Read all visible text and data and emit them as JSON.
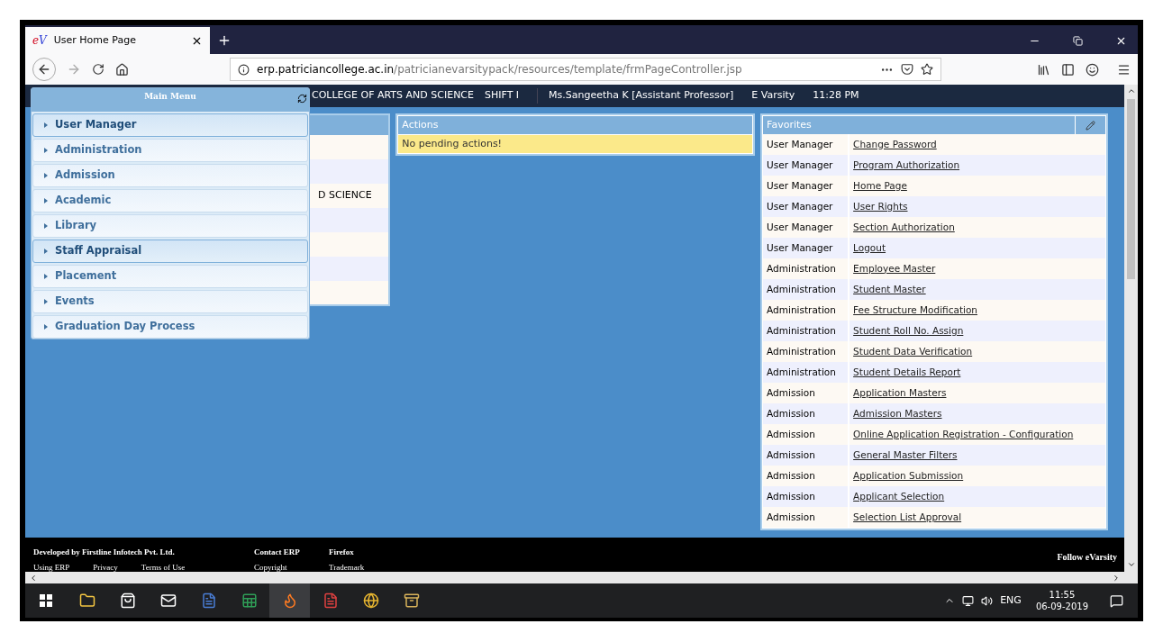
{
  "browser": {
    "logo": [
      "e",
      "V"
    ],
    "tab_title": "User Home Page",
    "url_host": "erp.patriciancollege.ac.in",
    "url_path": "/patricianevarsitypack/resources/template/frmPageController.jsp"
  },
  "header": {
    "college": "COLLEGE OF ARTS AND SCIENCE",
    "shift": "SHIFT I",
    "user": "Ms.Sangeetha K [Assistant Professor]",
    "app": "E Varsity",
    "time": "11:28 PM"
  },
  "main_menu": {
    "title": "Main Menu",
    "items": [
      {
        "label": "User Manager",
        "selected": true
      },
      {
        "label": "Administration",
        "selected": false
      },
      {
        "label": "Admission",
        "selected": false
      },
      {
        "label": "Academic",
        "selected": false
      },
      {
        "label": "Library",
        "selected": false
      },
      {
        "label": "Staff Appraisal",
        "selected": true
      },
      {
        "label": "Placement",
        "selected": false
      },
      {
        "label": "Events",
        "selected": false
      },
      {
        "label": "Graduation Day Process",
        "selected": false
      }
    ]
  },
  "info_panel": {
    "rows": [
      "",
      "",
      "D SCIENCE",
      "",
      "",
      "",
      ""
    ]
  },
  "actions": {
    "title": "Actions",
    "message": "No pending actions!"
  },
  "favorites": {
    "title": "Favorites",
    "rows": [
      {
        "module": "User Manager",
        "link": "Change Password"
      },
      {
        "module": "User Manager",
        "link": "Program Authorization"
      },
      {
        "module": "User Manager",
        "link": "Home Page"
      },
      {
        "module": "User Manager",
        "link": "User Rights"
      },
      {
        "module": "User Manager",
        "link": "Section Authorization"
      },
      {
        "module": "User Manager",
        "link": "Logout"
      },
      {
        "module": "Administration",
        "link": "Employee Master"
      },
      {
        "module": "Administration",
        "link": "Student Master"
      },
      {
        "module": "Administration",
        "link": "Fee Structure Modification"
      },
      {
        "module": "Administration",
        "link": "Student Roll No. Assign"
      },
      {
        "module": "Administration",
        "link": "Student Data Verification"
      },
      {
        "module": "Administration",
        "link": "Student Details Report"
      },
      {
        "module": "Admission",
        "link": "Application Masters"
      },
      {
        "module": "Admission",
        "link": "Admission Masters"
      },
      {
        "module": "Admission",
        "link": "Online Application Registration - Configuration"
      },
      {
        "module": "Admission",
        "link": "General Master Filters"
      },
      {
        "module": "Admission",
        "link": "Application Submission"
      },
      {
        "module": "Admission",
        "link": "Applicant Selection"
      },
      {
        "module": "Admission",
        "link": "Selection List Approval"
      }
    ]
  },
  "footer": {
    "groups": [
      {
        "title": "Developed by Firstline Infotech Pvt. Ltd.",
        "links": [
          "Using ERP",
          "Privacy",
          "Terms of Use"
        ]
      },
      {
        "title": "Contact ERP",
        "links": [
          "Copyright"
        ]
      },
      {
        "title": "Firefox",
        "links": [
          "Trademark"
        ]
      }
    ],
    "follow": "Follow eVarsity"
  },
  "taskbar": {
    "language": "ENG",
    "time": "11:55",
    "date": "06-09-2019"
  }
}
